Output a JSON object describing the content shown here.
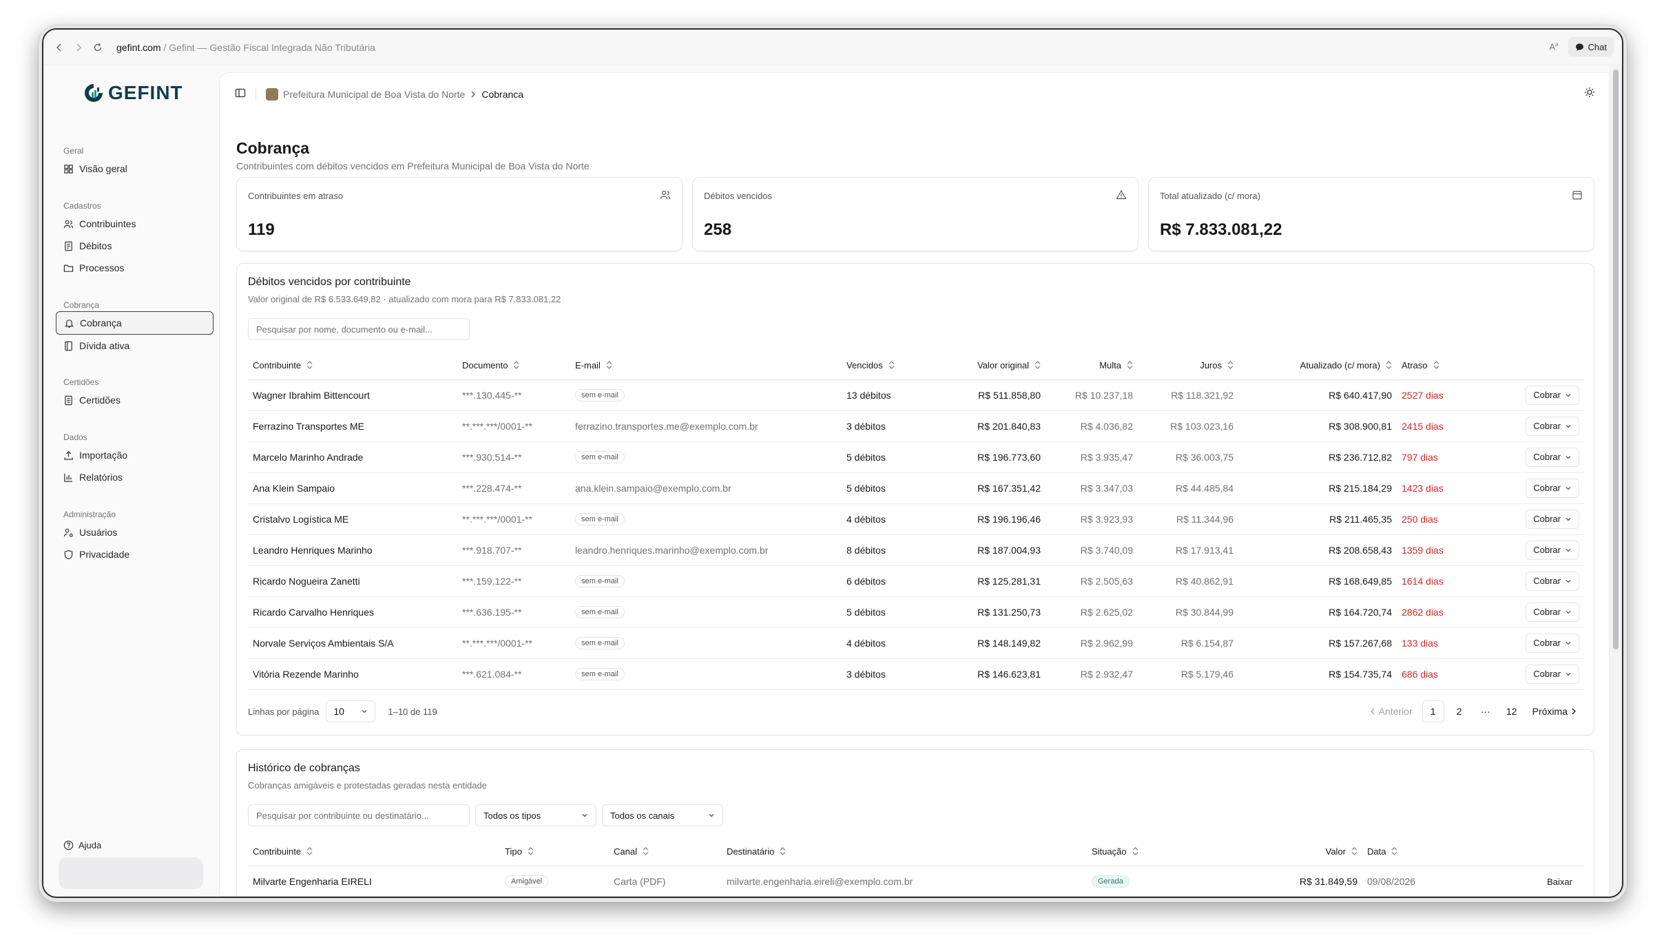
{
  "browser": {
    "host": "gefint.com",
    "rest": " / Gefint — Gestão Fiscal Integrada Não Tributária",
    "chat_label": "Chat"
  },
  "sidebar": {
    "logo": "GEFINT",
    "sections": [
      {
        "label": "Geral",
        "items": [
          {
            "label": "Visão geral",
            "icon": "grid-icon"
          }
        ]
      },
      {
        "label": "Cadastros",
        "items": [
          {
            "label": "Contribuintes",
            "icon": "users-icon"
          },
          {
            "label": "Débitos",
            "icon": "receipt-icon"
          },
          {
            "label": "Processos",
            "icon": "folder-icon"
          }
        ]
      },
      {
        "label": "Cobrança",
        "items": [
          {
            "label": "Cobrança",
            "icon": "bell-icon",
            "active": true
          },
          {
            "label": "Dívida ativa",
            "icon": "book-icon"
          }
        ]
      },
      {
        "label": "Certidões",
        "items": [
          {
            "label": "Certidões",
            "icon": "file-icon"
          }
        ]
      },
      {
        "label": "Dados",
        "items": [
          {
            "label": "Importação",
            "icon": "upload-icon"
          },
          {
            "label": "Relatórios",
            "icon": "bar-chart-icon"
          }
        ]
      },
      {
        "label": "Administração",
        "items": [
          {
            "label": "Usuários",
            "icon": "user-cog-icon"
          },
          {
            "label": "Privacidade",
            "icon": "shield-icon"
          }
        ]
      }
    ],
    "help_label": "Ajuda"
  },
  "topbar": {
    "entity": "Prefeitura Municipal de Boa Vista do Norte",
    "current": "Cobranca"
  },
  "page": {
    "title": "Cobrança",
    "subtitle": "Contribuintes com débitos vencidos em Prefeitura Municipal de Boa Vista do Norte"
  },
  "kpis": [
    {
      "label": "Contribuintes em atraso",
      "value": "119",
      "icon": "users-icon"
    },
    {
      "label": "Débitos vencidos",
      "value": "258",
      "icon": "alert-triangle-icon"
    },
    {
      "label": "Total atualizado (c/ mora)",
      "value": "R$ 7.833.081,22",
      "icon": "calendar-icon"
    }
  ],
  "debts": {
    "title": "Débitos vencidos por contribuinte",
    "subtitle": "Valor original de R$ 6.533.649,82 · atualizado com mora para R$ 7.833.081,22",
    "search_placeholder": "Pesquisar por nome, documento ou e-mail...",
    "columns": [
      "Contribuinte",
      "Documento",
      "E-mail",
      "Vencidos",
      "Valor original",
      "Multa",
      "Juros",
      "Atualizado (c/ mora)",
      "Atraso"
    ],
    "action_label": "Cobrar",
    "rows": [
      {
        "name": "Wagner Ibrahim Bittencourt",
        "doc": "***.130.445-**",
        "email": "sem e-mail",
        "noemail": true,
        "vencidos": "13 débitos",
        "original": "R$ 511.858,80",
        "multa": "R$ 10.237,18",
        "juros": "R$ 118.321,92",
        "atualizado": "R$ 640.417,90",
        "atraso": "2527 dias"
      },
      {
        "name": "Ferrazino Transportes ME",
        "doc": "**.***.***/0001-**",
        "email": "ferrazino.transportes.me@exemplo.com.br",
        "noemail": false,
        "vencidos": "3 débitos",
        "original": "R$ 201.840,83",
        "multa": "R$ 4.036,82",
        "juros": "R$ 103.023,16",
        "atualizado": "R$ 308.900,81",
        "atraso": "2415 dias"
      },
      {
        "name": "Marcelo Marinho Andrade",
        "doc": "***.930.514-**",
        "email": "sem e-mail",
        "noemail": true,
        "vencidos": "5 débitos",
        "original": "R$ 196.773,60",
        "multa": "R$ 3.935,47",
        "juros": "R$ 36.003,75",
        "atualizado": "R$ 236.712,82",
        "atraso": "797 dias"
      },
      {
        "name": "Ana Klein Sampaio",
        "doc": "***.228.474-**",
        "email": "ana.klein.sampaio@exemplo.com.br",
        "noemail": false,
        "vencidos": "5 débitos",
        "original": "R$ 167.351,42",
        "multa": "R$ 3.347,03",
        "juros": "R$ 44.485,84",
        "atualizado": "R$ 215.184,29",
        "atraso": "1423 dias"
      },
      {
        "name": "Cristalvo Logística ME",
        "doc": "**.***.***/0001-**",
        "email": "sem e-mail",
        "noemail": true,
        "vencidos": "4 débitos",
        "original": "R$ 196.196,46",
        "multa": "R$ 3.923,93",
        "juros": "R$ 11.344,96",
        "atualizado": "R$ 211.465,35",
        "atraso": "250 dias"
      },
      {
        "name": "Leandro Henriques Marinho",
        "doc": "***.918.707-**",
        "email": "leandro.henriques.marinho@exemplo.com.br",
        "noemail": false,
        "vencidos": "8 débitos",
        "original": "R$ 187.004,93",
        "multa": "R$ 3.740,09",
        "juros": "R$ 17.913,41",
        "atualizado": "R$ 208.658,43",
        "atraso": "1359 dias"
      },
      {
        "name": "Ricardo Nogueira Zanetti",
        "doc": "***.159.122-**",
        "email": "sem e-mail",
        "noemail": true,
        "vencidos": "6 débitos",
        "original": "R$ 125.281,31",
        "multa": "R$ 2.505,63",
        "juros": "R$ 40.862,91",
        "atualizado": "R$ 168.649,85",
        "atraso": "1614 dias"
      },
      {
        "name": "Ricardo Carvalho Henriques",
        "doc": "***.636.195-**",
        "email": "sem e-mail",
        "noemail": true,
        "vencidos": "5 débitos",
        "original": "R$ 131.250,73",
        "multa": "R$ 2.625,02",
        "juros": "R$ 30.844,99",
        "atualizado": "R$ 164.720,74",
        "atraso": "2862 dias"
      },
      {
        "name": "Norvale Serviços Ambientais S/A",
        "doc": "**.***.***/0001-**",
        "email": "sem e-mail",
        "noemail": true,
        "vencidos": "4 débitos",
        "original": "R$ 148.149,82",
        "multa": "R$ 2.962,99",
        "juros": "R$ 6.154,87",
        "atualizado": "R$ 157.267,68",
        "atraso": "133 dias"
      },
      {
        "name": "Vitória Rezende Marinho",
        "doc": "***.621.084-**",
        "email": "sem e-mail",
        "noemail": true,
        "vencidos": "3 débitos",
        "original": "R$ 146.623,81",
        "multa": "R$ 2.932,47",
        "juros": "R$ 5.179,46",
        "atualizado": "R$ 154.735,74",
        "atraso": "686 dias"
      }
    ],
    "pager": {
      "rows_label": "Linhas por página",
      "rows_value": "10",
      "range": "1–10 de 119",
      "prev": "Anterior",
      "pages": [
        "1",
        "2",
        "···",
        "12"
      ],
      "next": "Próxima"
    }
  },
  "history": {
    "title": "Histórico de cobranças",
    "subtitle": "Cobranças amigáveis e protestadas geradas nesta entidade",
    "search_placeholder": "Pesquisar por contribuinte ou destinatário...",
    "type_filter": "Todos os tipos",
    "channel_filter": "Todos os canais",
    "columns": [
      "Contribuinte",
      "Tipo",
      "Canal",
      "Destinatário",
      "Situação",
      "Valor",
      "Data"
    ],
    "rows": [
      {
        "name": "Milvarte Engenharia EIRELI",
        "tipo": "Amigável",
        "canal": "Carta (PDF)",
        "dest": "milvarte.engenharia.eireli@exemplo.com.br",
        "situacao": "Gerada",
        "valor": "R$ 31.849,59",
        "data": "09/08/2026",
        "action": "Baixar"
      }
    ]
  }
}
